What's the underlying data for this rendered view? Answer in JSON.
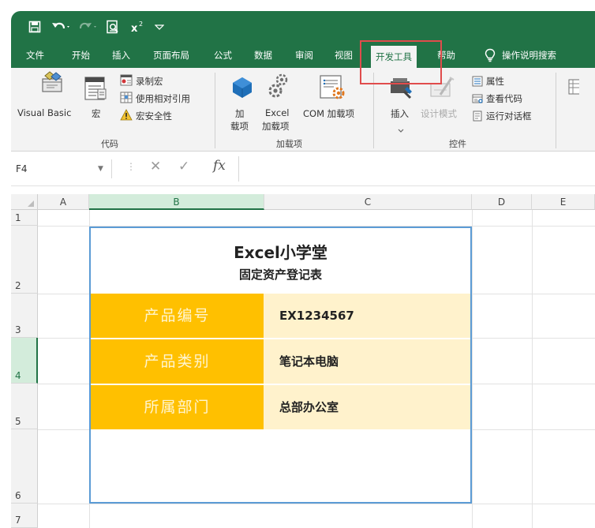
{
  "qat": {
    "save_icon": "save-icon",
    "undo_icon": "undo-icon",
    "redo_icon": "redo-icon",
    "print_preview_icon": "print-preview-icon",
    "superscript_icon": "superscript-icon",
    "customize_icon": "customize-qat-icon"
  },
  "tabs": [
    {
      "label": "文件"
    },
    {
      "label": "开始"
    },
    {
      "label": "插入"
    },
    {
      "label": "页面布局"
    },
    {
      "label": "公式"
    },
    {
      "label": "数据"
    },
    {
      "label": "审阅"
    },
    {
      "label": "视图"
    },
    {
      "label": "开发工具",
      "active": true
    },
    {
      "label": "帮助"
    }
  ],
  "tell_me": {
    "label": "操作说明搜索"
  },
  "ribbon": {
    "code": {
      "visual_basic": "Visual Basic",
      "macros": "宏",
      "record_macro": "录制宏",
      "relative_refs": "使用相对引用",
      "macro_security": "宏安全性",
      "group_label": "代码"
    },
    "addins": {
      "addins_line1": "加",
      "addins_line2": "载项",
      "excel_addins_line1": "Excel",
      "excel_addins_line2": "加载项",
      "com_addins": "COM 加载项",
      "group_label": "加载项"
    },
    "controls": {
      "insert": "插入",
      "design_mode": "设计模式",
      "properties": "属性",
      "view_code": "查看代码",
      "run_dialog": "运行对话框",
      "group_label": "控件"
    }
  },
  "formula_bar": {
    "name_box": "F4",
    "fx": "fx",
    "content": ""
  },
  "columns": [
    "A",
    "B",
    "C",
    "D",
    "E"
  ],
  "rows": [
    "1",
    "2",
    "3",
    "4",
    "5",
    "6",
    "7"
  ],
  "sheet": {
    "title": "Excel小学堂",
    "subtitle": "固定资产登记表",
    "fields": [
      {
        "label": "产品编号",
        "value": "EX1234567"
      },
      {
        "label": "产品类别",
        "value": "笔记本电脑"
      },
      {
        "label": "所属部门",
        "value": "总部办公室"
      }
    ]
  },
  "colors": {
    "excel_green": "#217346",
    "label_fill": "#ffc000",
    "value_fill": "#fff2cc",
    "table_border": "#5b9bd5",
    "highlight": "#e04c4c"
  }
}
